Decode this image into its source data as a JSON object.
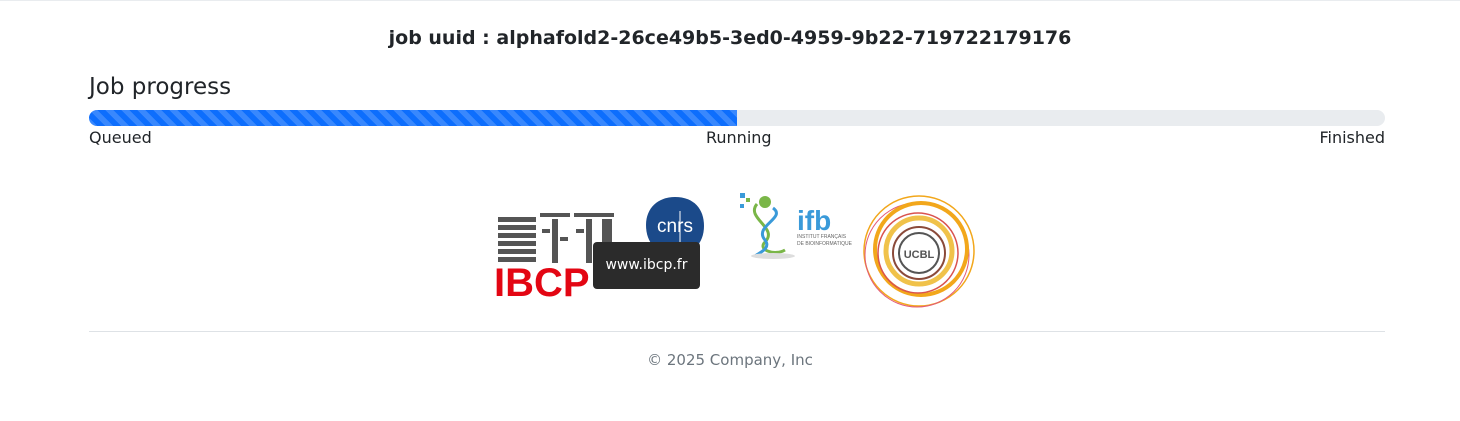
{
  "job": {
    "uuid_label": "job uuid :",
    "uuid_value": "alphafold2-26ce49b5-3ed0-4959-9b22-719722179176"
  },
  "progress": {
    "title": "Job progress",
    "fraction": 0.5,
    "stages": [
      "Queued",
      "Running",
      "Finished"
    ],
    "bar_color": "#0d6efd",
    "track_color": "#e9ecef"
  },
  "logos": {
    "ibcp_text": "IBCP",
    "cnrs_text": "cnrs",
    "ifb_text": "ifb",
    "ifb_sub1": "INSTITUT FRANÇAIS",
    "ifb_sub2": "DE BIOINFORMATIQUE",
    "ucbl_text": "UCBL",
    "ibcp_color": "#e30613"
  },
  "tooltip": {
    "text": "www.ibcp.fr"
  },
  "footer": {
    "copyright": "© 2025 Company, Inc"
  }
}
